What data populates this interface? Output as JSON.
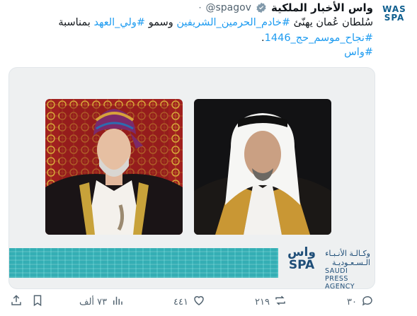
{
  "account": {
    "name": "واس الأخبار الملكية",
    "handle": "@spagov",
    "separator": "·",
    "avatar_line1": "WAS",
    "avatar_line2": "SPA"
  },
  "tweet": {
    "line1_text": "سُلطان عُمان يهنّئ",
    "line1_tag1": "#خادم_الحرمين_الشريفين",
    "line1_mid": "وسمو",
    "line1_tag2": "#ولي_العهد",
    "line1_end": "بمناسبة",
    "line2_tag": "#نجاح_موسم_حج_1446",
    "line2_end": ".",
    "line3_tag": "#واس"
  },
  "media": {
    "logo_mark_top": "واس",
    "logo_mark_bottom": "SPA",
    "logo_ar_line1": "وكـالـة الأنـبـاء",
    "logo_ar_line2": "الـسـعـوديـة",
    "logo_en_line1": "SAUDI PRESS",
    "logo_en_line2": "AGENCY"
  },
  "actions": {
    "replies": "٣٠",
    "retweets": "٢١٩",
    "likes": "٤٤١",
    "views": "٧٣ ألف"
  },
  "colors": {
    "link": "#1d9bf0",
    "muted": "#536471",
    "verified": "#829aab",
    "accent_bar": "#3fb6ba"
  }
}
